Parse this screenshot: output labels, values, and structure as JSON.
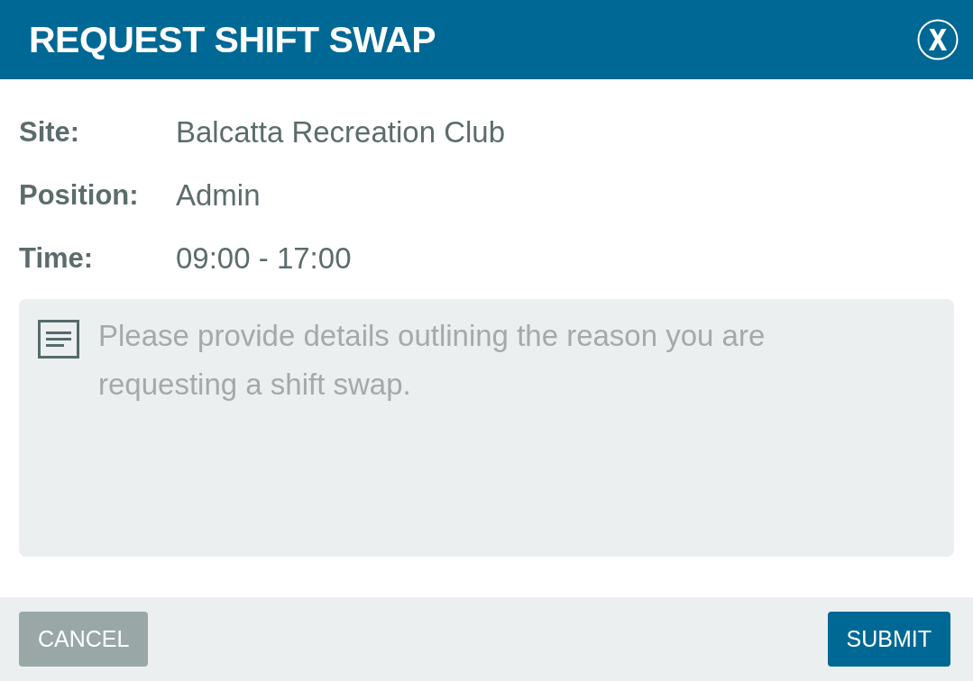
{
  "dialog": {
    "title": "REQUEST SHIFT SWAP",
    "fields": [
      {
        "label": "Site:",
        "value": "Balcatta Recreation Club"
      },
      {
        "label": "Position:",
        "value": "Admin"
      },
      {
        "label": "Time:",
        "value": "09:00 - 17:00"
      }
    ],
    "details": {
      "placeholder": "Please provide details outlining the reason you are requesting a shift swap."
    },
    "buttons": [
      {
        "label": "CANCEL",
        "kind": "secondary"
      },
      {
        "label": "SUBMIT",
        "kind": "primary"
      }
    ]
  }
}
